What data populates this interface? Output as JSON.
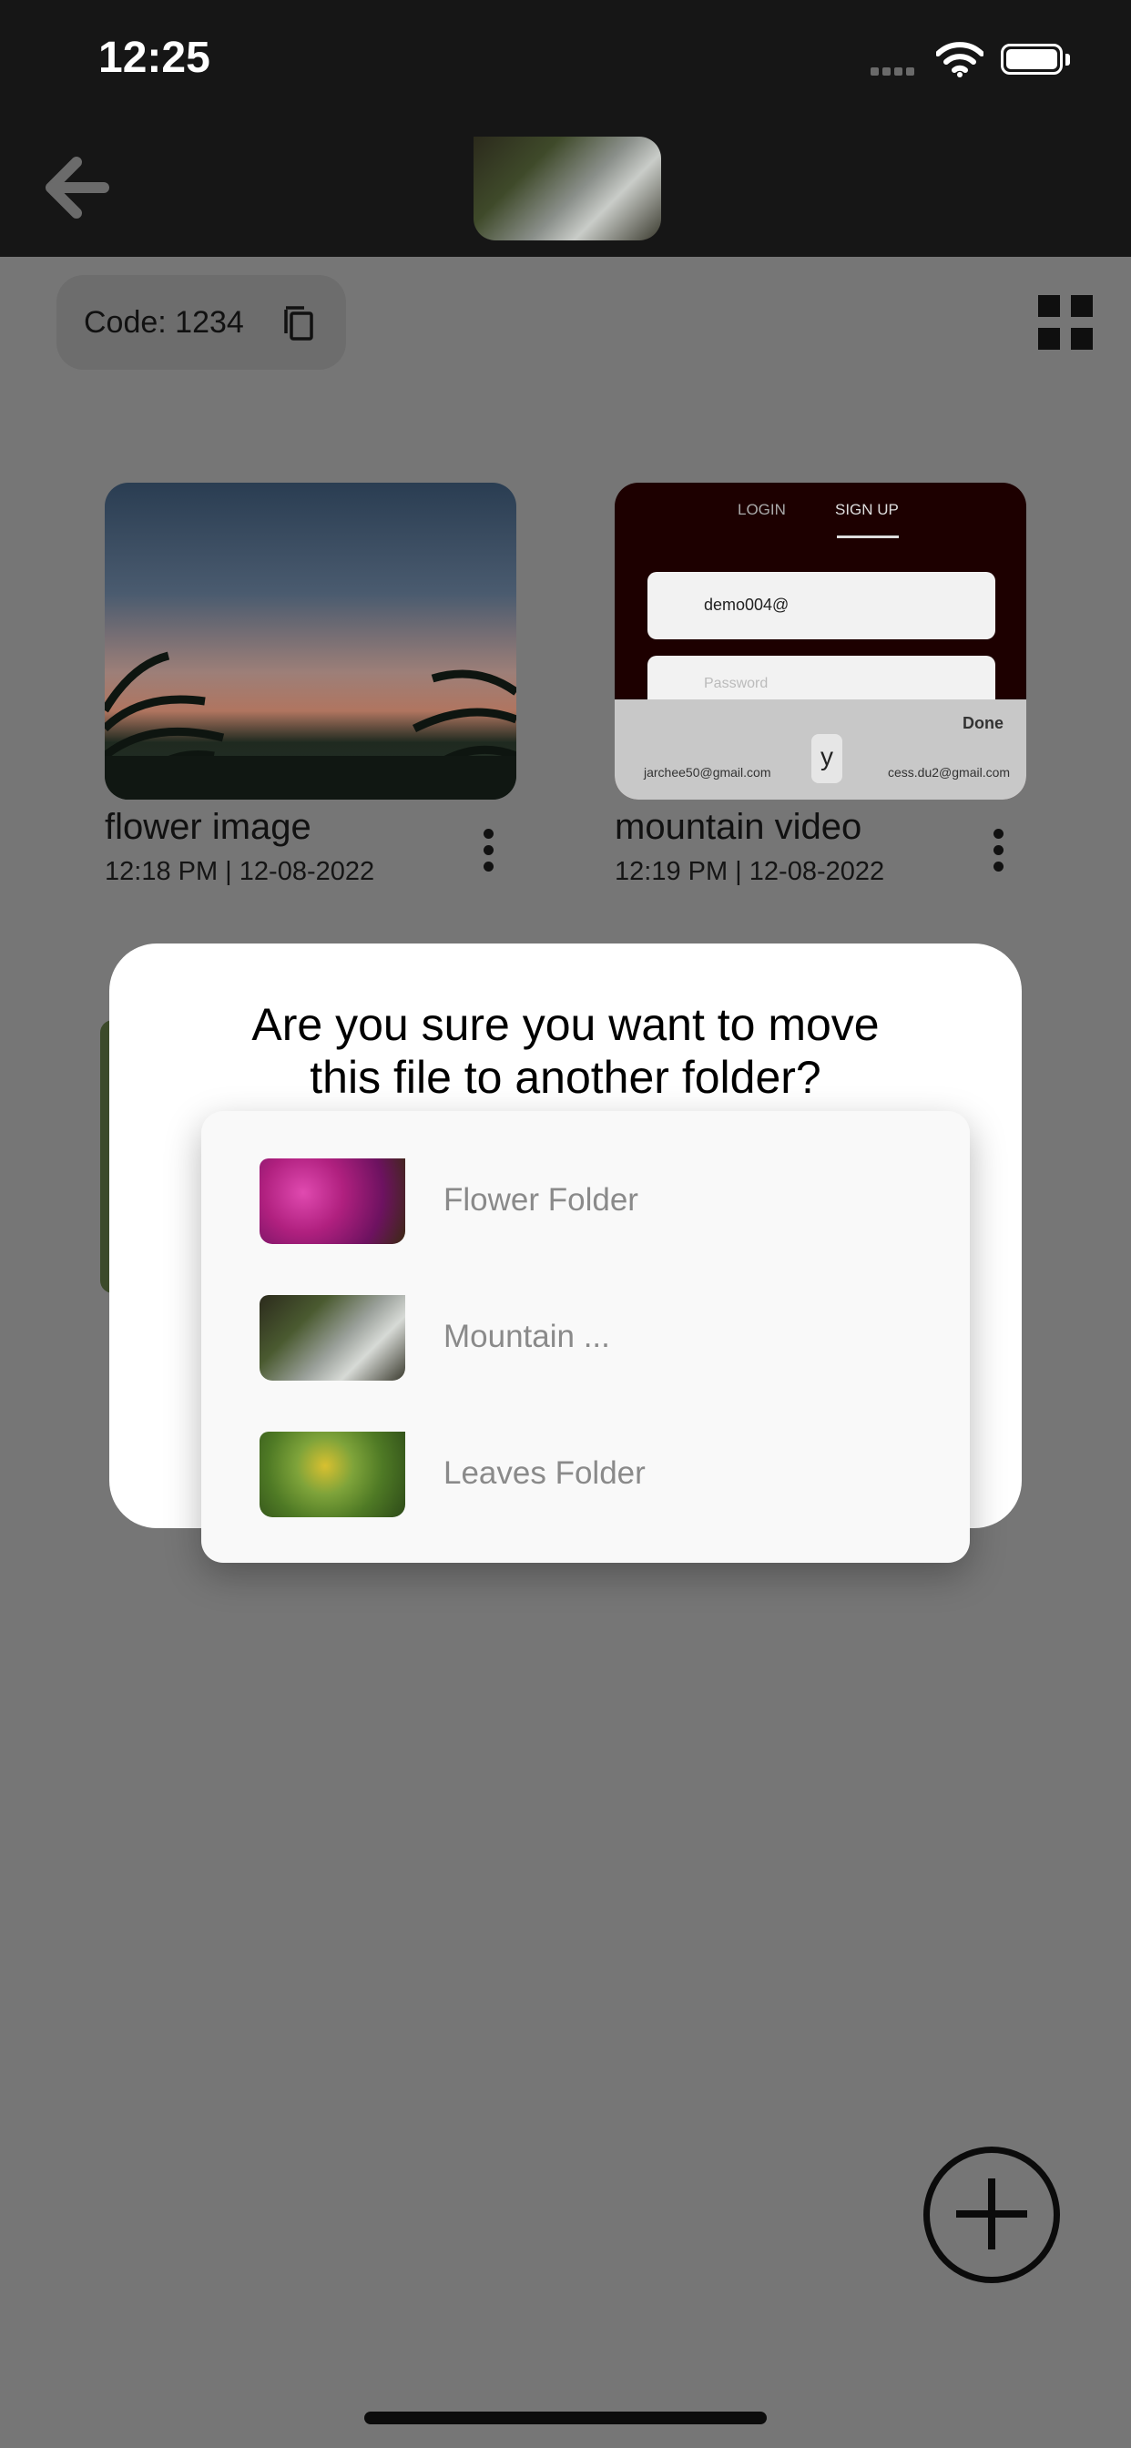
{
  "status_bar": {
    "time": "12:25"
  },
  "header": {
    "back_icon": "arrow-left-icon",
    "thumbnail": "mountain-waterfall-folder-thumbnail"
  },
  "toolbar": {
    "code_label": "Code: 1234",
    "copy_icon": "copy-icon",
    "view_icon": "grid-view-icon"
  },
  "files": [
    {
      "title": "flower image",
      "meta": "12:18 PM | 12-08-2022"
    },
    {
      "title": "mountain video",
      "meta": "12:19 PM | 12-08-2022",
      "preview": {
        "tab_login": "LOGIN",
        "tab_signup": "SIGN UP",
        "email": "demo004@",
        "password_placeholder": "Password",
        "done": "Done",
        "suggestion_left": "jarchee50@gmail.com",
        "suggestion_key": "y",
        "suggestion_right": "cess.du2@gmail.com"
      }
    }
  ],
  "dialog": {
    "title_line1": "Are  you sure you want to move",
    "title_line2": "this file to another folder?",
    "folders": [
      {
        "label": "Flower Folder"
      },
      {
        "label": "Mountain ..."
      },
      {
        "label": "Leaves Folder"
      }
    ]
  },
  "fab": {
    "icon": "plus-icon"
  },
  "colors": {
    "overlay": "#767676",
    "header_bg": "#161616",
    "dialog_bg": "#ffffff",
    "menu_text": "#8a8a8a"
  }
}
